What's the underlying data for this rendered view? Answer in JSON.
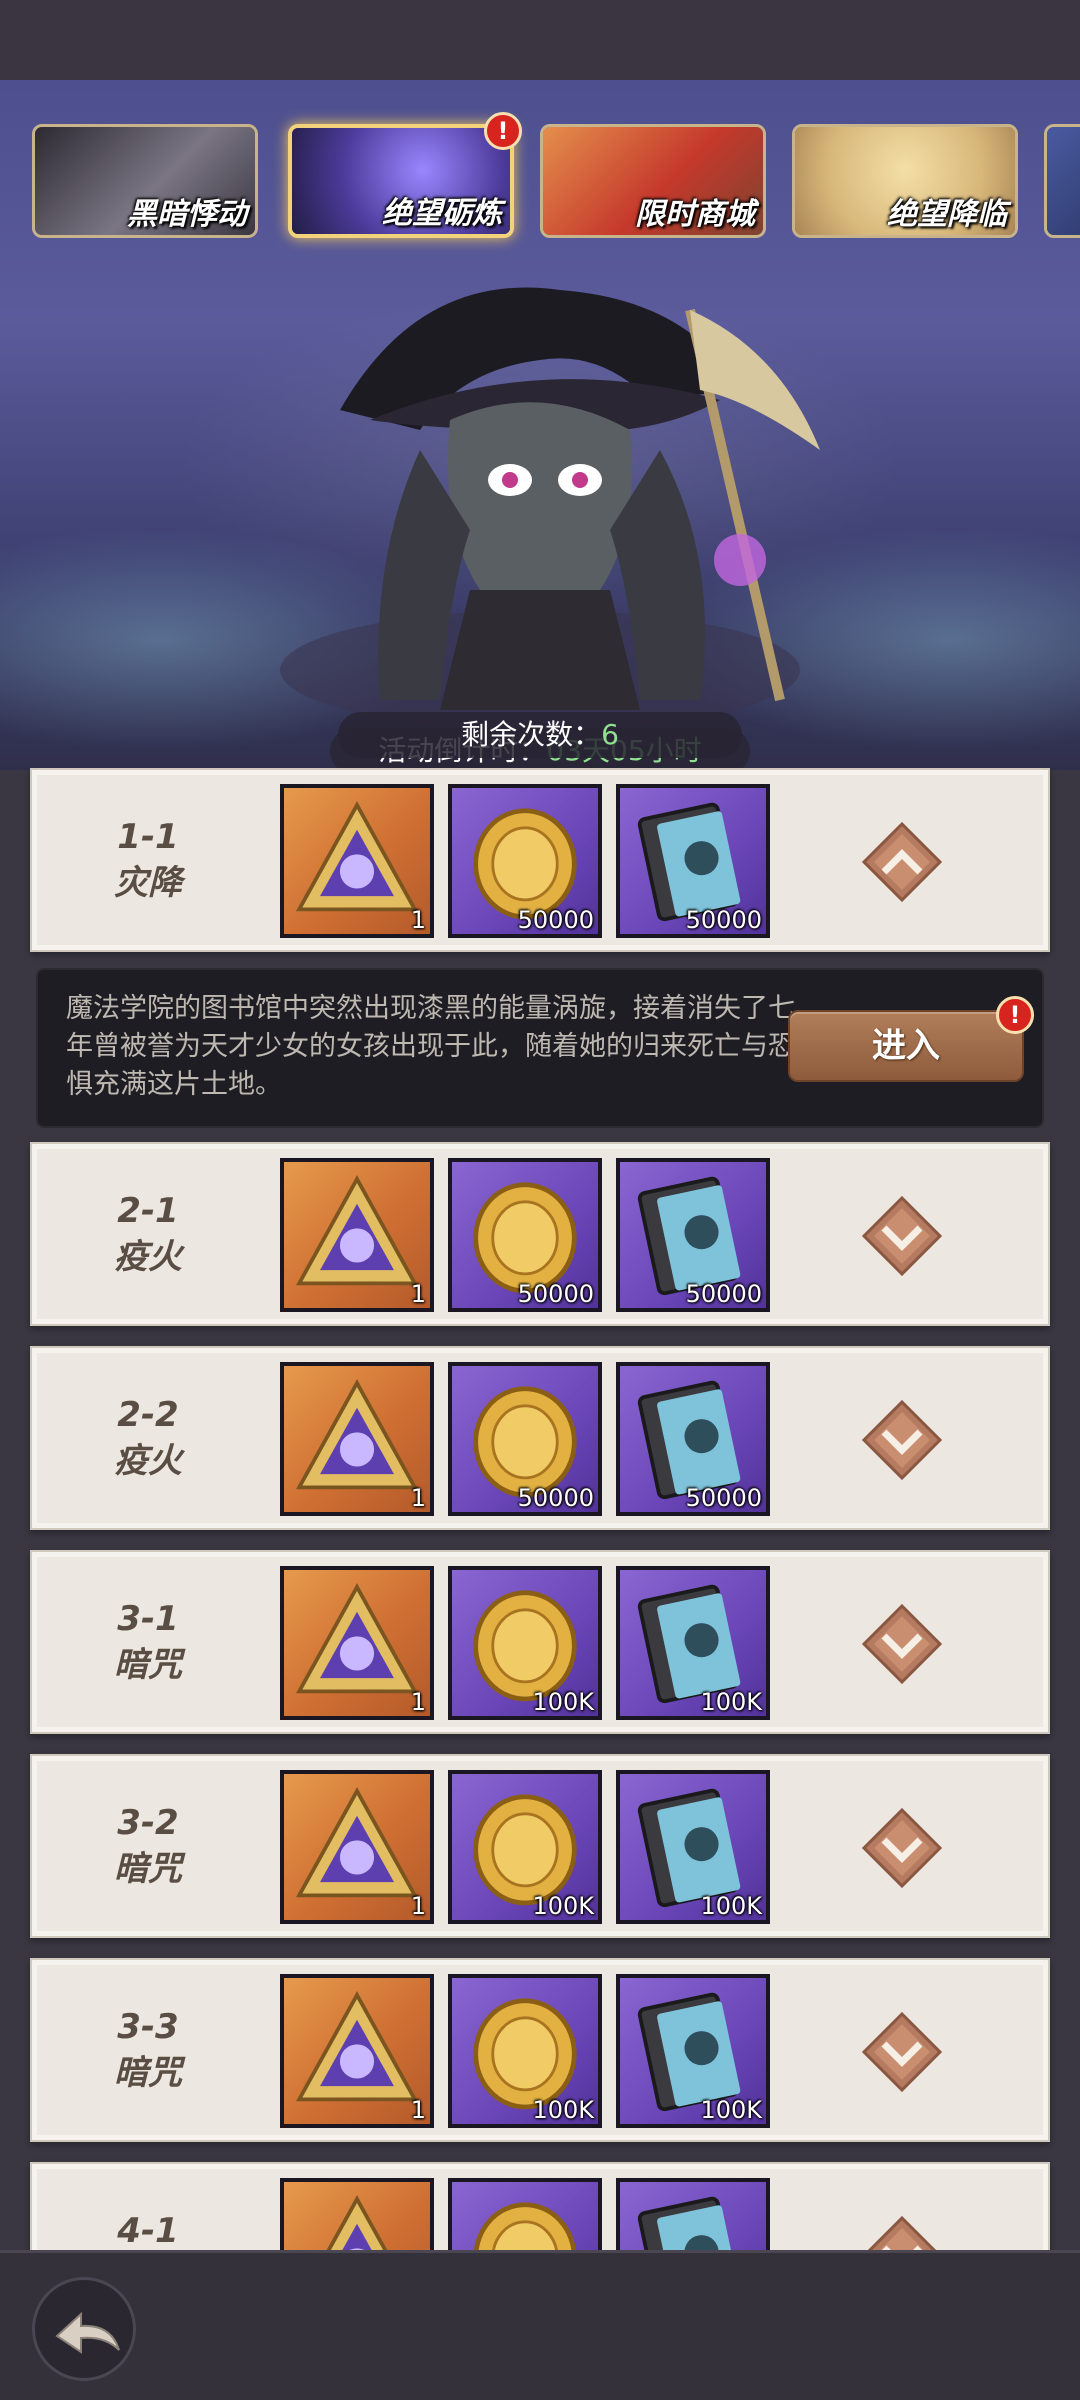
{
  "tabs": [
    {
      "label": "黑暗悸动",
      "active": false,
      "alert": false
    },
    {
      "label": "绝望砺炼",
      "active": true,
      "alert": true
    },
    {
      "label": "限时商城",
      "active": false,
      "alert": false
    },
    {
      "label": "绝望降临",
      "active": false,
      "alert": false
    }
  ],
  "alert_glyph": "!",
  "event": {
    "countdown_label": "活动倒计时：",
    "countdown_value": "03天05小时",
    "remaining_label": "剩余次数：",
    "remaining_value": "6"
  },
  "stages": [
    {
      "number": "1-1",
      "name": "灾降",
      "rewards": [
        "1",
        "50000",
        "50000"
      ],
      "expanded": true
    },
    {
      "number": "2-1",
      "name": "疫火",
      "rewards": [
        "1",
        "50000",
        "50000"
      ],
      "expanded": false
    },
    {
      "number": "2-2",
      "name": "疫火",
      "rewards": [
        "1",
        "50000",
        "50000"
      ],
      "expanded": false
    },
    {
      "number": "3-1",
      "name": "暗咒",
      "rewards": [
        "1",
        "100K",
        "100K"
      ],
      "expanded": false
    },
    {
      "number": "3-2",
      "name": "暗咒",
      "rewards": [
        "1",
        "100K",
        "100K"
      ],
      "expanded": false
    },
    {
      "number": "3-3",
      "name": "暗咒",
      "rewards": [
        "1",
        "100K",
        "100K"
      ],
      "expanded": false
    },
    {
      "number": "4-1",
      "name": "",
      "rewards": [
        "",
        "",
        ""
      ],
      "expanded": false
    }
  ],
  "reward_icons": [
    "dark-triangle-emblem-icon",
    "gold-coin-icon",
    "fist-card-icon"
  ],
  "stage_detail": {
    "description": "魔法学院的图书馆中突然出现漆黑的能量涡旋，接着消失了七年曾被誉为天才少女的女孩出现于此，随着她的归来死亡与恐惧充满这片土地。",
    "enter_label": "进入",
    "enter_alert": true
  },
  "colors": {
    "accent_gold": "#f2d27a",
    "timer_green": "#8fe08f",
    "alert_red": "#d8241f"
  }
}
